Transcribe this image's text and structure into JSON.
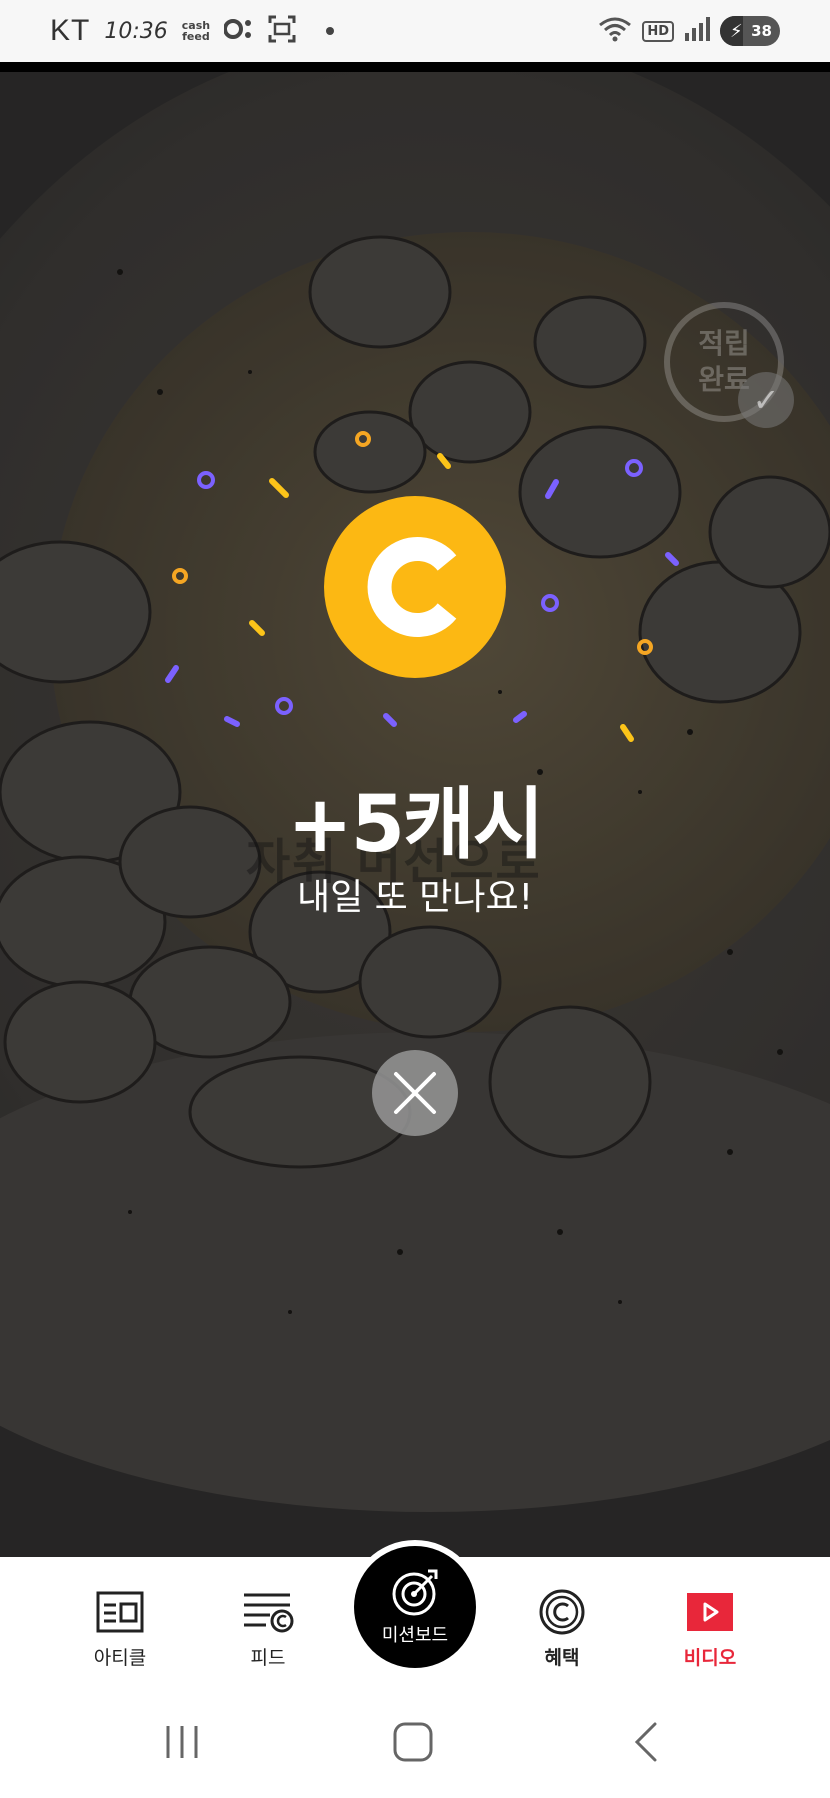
{
  "status_bar": {
    "carrier": "KT",
    "time": "10:36",
    "app_badge_top": "cash",
    "app_badge_bottom": "feed",
    "hd_label": "HD",
    "battery_level": "38",
    "battery_fraction": 0.38
  },
  "stamp": {
    "line1": "적립",
    "line2": "완료"
  },
  "video": {
    "ghost_caption": "자취 머선으로"
  },
  "reward": {
    "coin_letter": "C",
    "title": "+5캐시",
    "subtitle": "내일 또 만나요!"
  },
  "tabs": {
    "article": "아티클",
    "feed": "피드",
    "mission": "미션보드",
    "benefit": "혜택",
    "video": "비디오"
  },
  "colors": {
    "coin": "#fcb813",
    "active_tab": "#e8273a",
    "confetti_purple": "#7b61ff",
    "confetti_yellow": "#fcc419",
    "confetti_orange": "#f5a623"
  },
  "icons": {
    "close": "close-icon",
    "article": "article-icon",
    "feed": "feed-icon",
    "mission": "target-icon",
    "benefit": "coin-icon",
    "video": "play-icon"
  }
}
